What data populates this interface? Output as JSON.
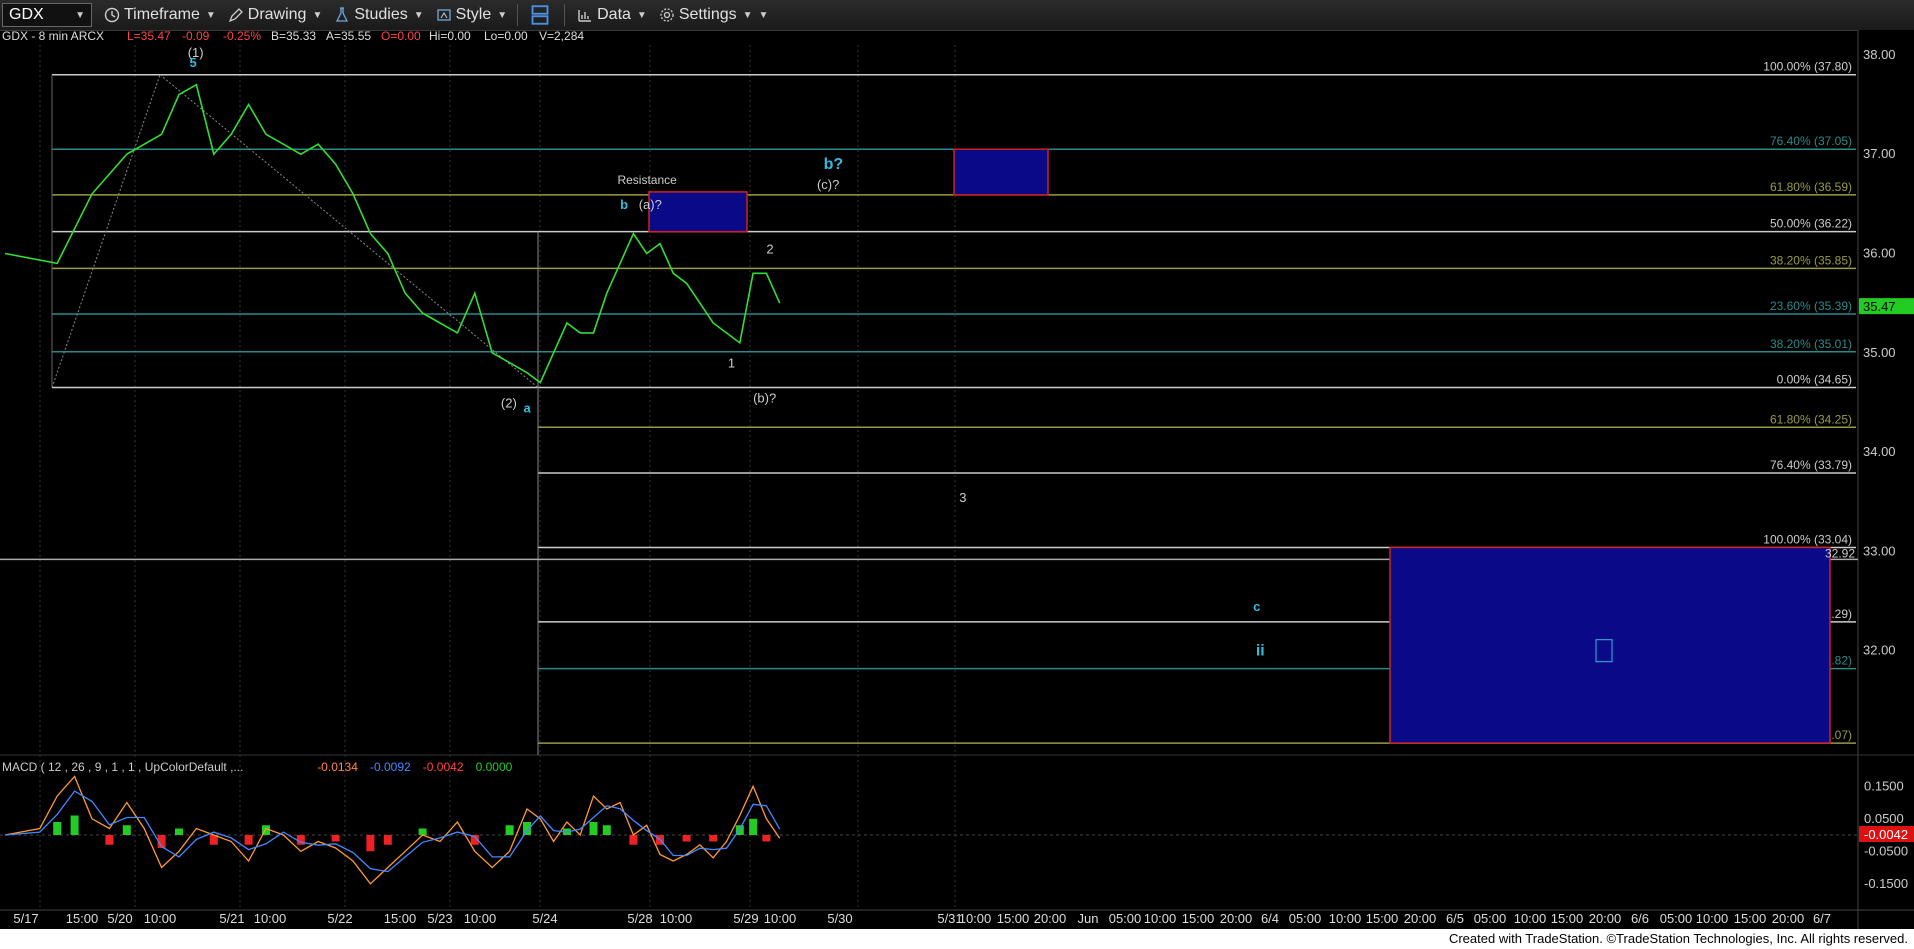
{
  "toolbar": {
    "symbol": "GDX",
    "timeframe_label": "Timeframe",
    "drawing_label": "Drawing",
    "studies_label": "Studies",
    "style_label": "Style",
    "data_label": "Data",
    "settings_label": "Settings"
  },
  "header": {
    "symbol_info": "GDX - 8 min  ARCX",
    "last": "L=35.47",
    "change": "-0.09",
    "change_pct": "-0.25%",
    "bid": "B=35.33",
    "ask": "A=35.55",
    "open": "O=0.00",
    "high": "Hi=0.00",
    "low": "Lo=0.00",
    "volume": "V=2,284"
  },
  "macd_label": {
    "title": "MACD ( 12 , 26 , 9 , 1 , 1 , UpColorDefault ,...",
    "v1": "-0.0134",
    "v2": "-0.0092",
    "v3": "-0.0042",
    "v4": "0.0000"
  },
  "footer": {
    "credit": "Created with TradeStation. ©TradeStation Technologies, Inc. All rights reserved."
  },
  "colors": {
    "background": "#000000",
    "price": "#33dd33",
    "fib_white": "#cccccc",
    "fib_teal": "#2a8a8a",
    "fib_olive": "#9a9a44",
    "box_fill": "#0a0a88",
    "box_edge": "#cc2222",
    "label_cyan": "#33bbdd"
  },
  "chart_data": {
    "type": "line",
    "title": "",
    "current_price": 35.47,
    "last_price_marker": "35.47",
    "alt_price_marker": "32.92",
    "ylim": [
      30.95,
      38.2
    ],
    "y_ticks": [
      38.0,
      37.0,
      36.0,
      35.0,
      34.0,
      33.0,
      32.0
    ],
    "y_tick_labels": [
      "38.00",
      "37.00",
      "36.00",
      "35.00",
      "34.00",
      "33.00",
      "32.00"
    ],
    "x_tick_labels": [
      "5/17",
      "15:00",
      "5/20",
      "10:00",
      "5/21",
      "10:00",
      "5/22",
      "15:00",
      "5/23",
      "10:00",
      "5/24",
      "5/28",
      "10:00",
      "5/29",
      "10:00",
      "5/30",
      "5/31",
      "10:00",
      "15:00",
      "20:00",
      "Jun",
      "05:00",
      "10:00",
      "15:00",
      "20:00",
      "6/4",
      "05:00",
      "10:00",
      "15:00",
      "20:00",
      "6/5",
      "05:00",
      "10:00",
      "15:00",
      "20:00",
      "6/6",
      "05:00",
      "10:00",
      "15:00",
      "20:00",
      "6/7"
    ],
    "price_series": [
      [
        0,
        36.0
      ],
      [
        3,
        35.9
      ],
      [
        5,
        36.6
      ],
      [
        7,
        37.0
      ],
      [
        9,
        37.2
      ],
      [
        10,
        37.6
      ],
      [
        11,
        37.7
      ],
      [
        12,
        37.0
      ],
      [
        13,
        37.2
      ],
      [
        14,
        37.5
      ],
      [
        15,
        37.2
      ],
      [
        16,
        37.1
      ],
      [
        17,
        37.0
      ],
      [
        18,
        37.1
      ],
      [
        19,
        36.9
      ],
      [
        20,
        36.6
      ],
      [
        21,
        36.2
      ],
      [
        22,
        36.0
      ],
      [
        23,
        35.6
      ],
      [
        24,
        35.4
      ],
      [
        25,
        35.3
      ],
      [
        26,
        35.2
      ],
      [
        27,
        35.6
      ],
      [
        28,
        35.0
      ],
      [
        29,
        34.9
      ],
      [
        30,
        34.8
      ],
      [
        31,
        34.7
      ],
      [
        32,
        35.0
      ],
      [
        33,
        35.3
      ],
      [
        34,
        35.2
      ],
      [
        35,
        35.2
      ],
      [
        36,
        35.6
      ],
      [
        37,
        35.9
      ],
      [
        38,
        36.2
      ],
      [
        39,
        36.0
      ],
      [
        40,
        36.1
      ],
      [
        41,
        35.8
      ],
      [
        42,
        35.7
      ],
      [
        43,
        35.5
      ],
      [
        44,
        35.3
      ],
      [
        45,
        35.2
      ],
      [
        46,
        35.1
      ],
      [
        47,
        35.8
      ],
      [
        48,
        35.8
      ],
      [
        49,
        35.5
      ]
    ],
    "fib_levels": [
      {
        "label": "100.00% (37.80)",
        "value": 37.8,
        "color": "white"
      },
      {
        "label": "76.40% (37.05)",
        "value": 37.05,
        "color": "teal"
      },
      {
        "label": "61.80% (36.59)",
        "value": 36.59,
        "color": "olive"
      },
      {
        "label": "50.00% (36.22)",
        "value": 36.22,
        "color": "white"
      },
      {
        "label": "38.20% (35.85)",
        "value": 35.85,
        "color": "olive"
      },
      {
        "label": "23.60% (35.39)",
        "value": 35.39,
        "color": "teal"
      },
      {
        "label": "38.20% (35.01)",
        "value": 35.01,
        "color": "teal"
      },
      {
        "label": "0.00% (34.65)",
        "value": 34.65,
        "color": "white"
      },
      {
        "label": "61.80% (34.25)",
        "value": 34.25,
        "color": "olive"
      },
      {
        "label": "76.40% (33.79)",
        "value": 33.79,
        "color": "white"
      },
      {
        "label": "100.00% (33.04)",
        "value": 33.04,
        "color": "white"
      },
      {
        "label": "123.60% (32.29)",
        "value": 32.29,
        "color": "white"
      },
      {
        "label": "138.20% (31.82)",
        "value": 31.82,
        "color": "teal"
      },
      {
        "label": "161.80% (31.07)",
        "value": 31.07,
        "color": "olive"
      }
    ],
    "annotations": [
      {
        "text": "(1)",
        "x": 10.5,
        "y": 37.98
      },
      {
        "text": "5",
        "x": 10.6,
        "y": 37.88
      },
      {
        "text": "(2)",
        "x": 28.5,
        "y": 34.45
      },
      {
        "text": "a",
        "x": 29.8,
        "y": 34.4
      },
      {
        "text": "Resistance",
        "x": 36.8,
        "y": 36.7
      },
      {
        "text": "b",
        "x": 37.0,
        "y": 36.45
      },
      {
        "text": "(a)?",
        "x": 38.4,
        "y": 36.45
      },
      {
        "text": "2",
        "x": 48.0,
        "y": 36.0
      },
      {
        "text": "1",
        "x": 45.1,
        "y": 34.85
      },
      {
        "text": "(b)?",
        "x": 47.0,
        "y": 34.5
      },
      {
        "text": "b?",
        "x": 52.3,
        "y": 36.85
      },
      {
        "text": "(c)?",
        "x": 51.8,
        "y": 36.65
      },
      {
        "text": "3",
        "x": 62.5,
        "y": 33.5
      },
      {
        "text": "c",
        "x": 84.6,
        "y": 32.4
      },
      {
        "text": "ii",
        "x": 84.8,
        "y": 31.95
      }
    ],
    "macd": {
      "ylim": [
        -0.2,
        0.2
      ],
      "y_ticks": [
        0.15,
        0.05,
        -0.05,
        -0.15
      ],
      "y_tick_labels": [
        "0.1500",
        "0.0500",
        "-0.0500",
        "-0.1500"
      ],
      "current_marker": "-0.0042",
      "macd_line": [
        [
          0,
          0.0
        ],
        [
          2,
          0.02
        ],
        [
          3,
          0.12
        ],
        [
          4,
          0.18
        ],
        [
          5,
          0.05
        ],
        [
          6,
          0.02
        ],
        [
          7,
          0.1
        ],
        [
          8,
          0.02
        ],
        [
          9,
          -0.1
        ],
        [
          10,
          -0.05
        ],
        [
          11,
          0.02
        ],
        [
          12,
          0.0
        ],
        [
          13,
          -0.02
        ],
        [
          14,
          -0.08
        ],
        [
          15,
          0.02
        ],
        [
          16,
          0.0
        ],
        [
          17,
          -0.05
        ],
        [
          18,
          -0.02
        ],
        [
          19,
          -0.04
        ],
        [
          20,
          -0.08
        ],
        [
          21,
          -0.15
        ],
        [
          22,
          -0.1
        ],
        [
          23,
          -0.05
        ],
        [
          24,
          0.0
        ],
        [
          25,
          -0.02
        ],
        [
          26,
          0.04
        ],
        [
          27,
          -0.05
        ],
        [
          28,
          -0.1
        ],
        [
          29,
          -0.05
        ],
        [
          30,
          0.08
        ],
        [
          31,
          0.05
        ],
        [
          32,
          -0.02
        ],
        [
          33,
          0.04
        ],
        [
          34,
          0.0
        ],
        [
          35,
          0.12
        ],
        [
          36,
          0.08
        ],
        [
          37,
          0.1
        ],
        [
          38,
          0.0
        ],
        [
          39,
          0.03
        ],
        [
          40,
          -0.06
        ],
        [
          41,
          -0.08
        ],
        [
          42,
          -0.06
        ],
        [
          43,
          -0.03
        ],
        [
          44,
          -0.07
        ],
        [
          45,
          -0.02
        ],
        [
          46,
          0.06
        ],
        [
          47,
          0.15
        ],
        [
          48,
          0.05
        ],
        [
          49,
          -0.01
        ]
      ],
      "histogram": [
        [
          3,
          0.04
        ],
        [
          4,
          0.06
        ],
        [
          6,
          -0.03
        ],
        [
          7,
          0.03
        ],
        [
          9,
          -0.04
        ],
        [
          10,
          0.02
        ],
        [
          12,
          -0.03
        ],
        [
          14,
          -0.03
        ],
        [
          15,
          0.03
        ],
        [
          17,
          -0.03
        ],
        [
          19,
          -0.02
        ],
        [
          21,
          -0.05
        ],
        [
          22,
          -0.03
        ],
        [
          24,
          0.02
        ],
        [
          27,
          -0.03
        ],
        [
          29,
          0.03
        ],
        [
          30,
          0.04
        ],
        [
          33,
          0.02
        ],
        [
          35,
          0.04
        ],
        [
          36,
          0.03
        ],
        [
          38,
          -0.03
        ],
        [
          40,
          -0.03
        ],
        [
          42,
          -0.02
        ],
        [
          44,
          -0.02
        ],
        [
          46,
          0.03
        ],
        [
          47,
          0.05
        ],
        [
          48,
          -0.02
        ]
      ]
    }
  }
}
